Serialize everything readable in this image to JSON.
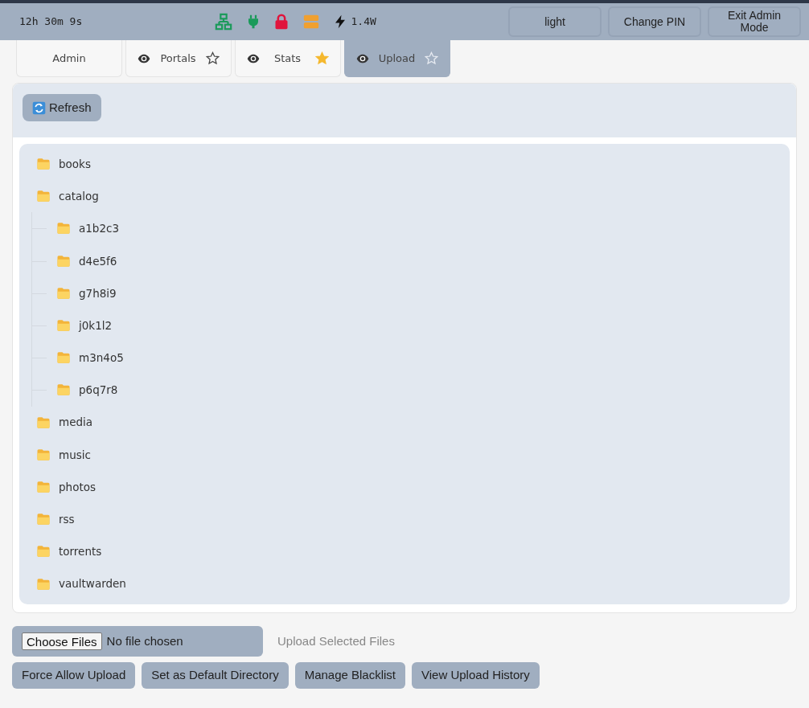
{
  "status_bar": {
    "uptime": "12h 30m 9s",
    "power": "1.4W",
    "buttons": [
      "light",
      "Change PIN",
      "Exit Admin Mode"
    ]
  },
  "tabs": [
    {
      "label": "Admin",
      "kind": "plain",
      "selected": false
    },
    {
      "label": "Portals",
      "kind": "portal",
      "selected": false,
      "starred": false
    },
    {
      "label": "Stats",
      "kind": "portal",
      "selected": false,
      "starred": true
    },
    {
      "label": "Upload",
      "kind": "portal",
      "selected": true,
      "starred": false
    }
  ],
  "refresh_button": "Refresh",
  "tree": [
    {
      "name": "books"
    },
    {
      "name": "catalog",
      "children": [
        {
          "name": "a1b2c3"
        },
        {
          "name": "d4e5f6"
        },
        {
          "name": "g7h8i9"
        },
        {
          "name": "j0k1l2"
        },
        {
          "name": "m3n4o5"
        },
        {
          "name": "p6q7r8"
        }
      ]
    },
    {
      "name": "media"
    },
    {
      "name": "music"
    },
    {
      "name": "photos"
    },
    {
      "name": "rss"
    },
    {
      "name": "torrents"
    },
    {
      "name": "vaultwarden"
    }
  ],
  "file_picker": {
    "button": "Choose Files",
    "value": "No file chosen"
  },
  "upload_button": {
    "label": "Upload Selected Files",
    "disabled": true
  },
  "actions": [
    "Force Allow Upload",
    "Set as Default Directory",
    "Manage Blacklist",
    "View Upload History"
  ]
}
